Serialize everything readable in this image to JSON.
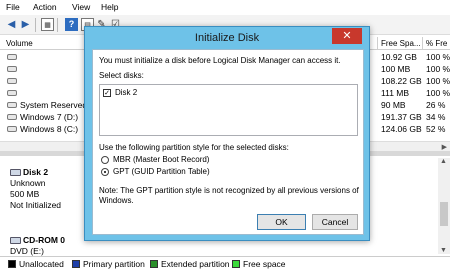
{
  "menu": {
    "file": "File",
    "action": "Action",
    "view": "View",
    "help": "Help"
  },
  "toolbar": {
    "icons": [
      "back-arrow-icon",
      "forward-arrow-icon",
      "grid-icon",
      "help-icon",
      "doc-icon",
      "properties-icon",
      "checklist-icon"
    ]
  },
  "volume_table": {
    "headers": {
      "volume": "Volume",
      "free_space": "Free Spa...",
      "percent_free": "% Fre"
    },
    "rows": [
      {
        "name": "",
        "free": "10.92 GB",
        "pct": "100 %"
      },
      {
        "name": "",
        "free": "100 MB",
        "pct": "100 %"
      },
      {
        "name": "",
        "free": "108.22 GB",
        "pct": "100 %"
      },
      {
        "name": "",
        "free": "111 MB",
        "pct": "100 %"
      },
      {
        "name": "System Reserved",
        "free": "90 MB",
        "pct": "26 %"
      },
      {
        "name": "Windows 7 (D:)",
        "free": "191.37 GB",
        "pct": "34 %"
      },
      {
        "name": "Windows 8 (C:)",
        "free": "124.06 GB",
        "pct": "52 %"
      }
    ]
  },
  "disk2": {
    "title": "Disk 2",
    "status": "Unknown",
    "size": "500 MB",
    "state": "Not Initialized"
  },
  "cdrom": {
    "title": "CD-ROM 0",
    "drive": "DVD (E:)"
  },
  "legend": {
    "unallocated": "Unallocated",
    "primary": "Primary partition",
    "extended": "Extended partition",
    "free": "Free space",
    "colors": {
      "unallocated": "#000000",
      "primary": "#1e3fa8",
      "extended": "#2a8f2a",
      "free": "#3ddc3d"
    }
  },
  "dialog": {
    "title": "Initialize Disk",
    "close_label": "✕",
    "message": "You must initialize a disk before Logical Disk Manager can access it.",
    "select_label": "Select disks:",
    "disk_item": "Disk 2",
    "partition_prompt": "Use the following partition style for the selected disks:",
    "mbr_label": "MBR (Master Boot Record)",
    "gpt_label": "GPT (GUID Partition Table)",
    "note_line1": "Note: The GPT partition style is not recognized by all previous versions of",
    "note_line2": "Windows.",
    "ok_label": "OK",
    "cancel_label": "Cancel",
    "title_bar_color": "#6ec2e8",
    "close_color": "#c8382c"
  }
}
